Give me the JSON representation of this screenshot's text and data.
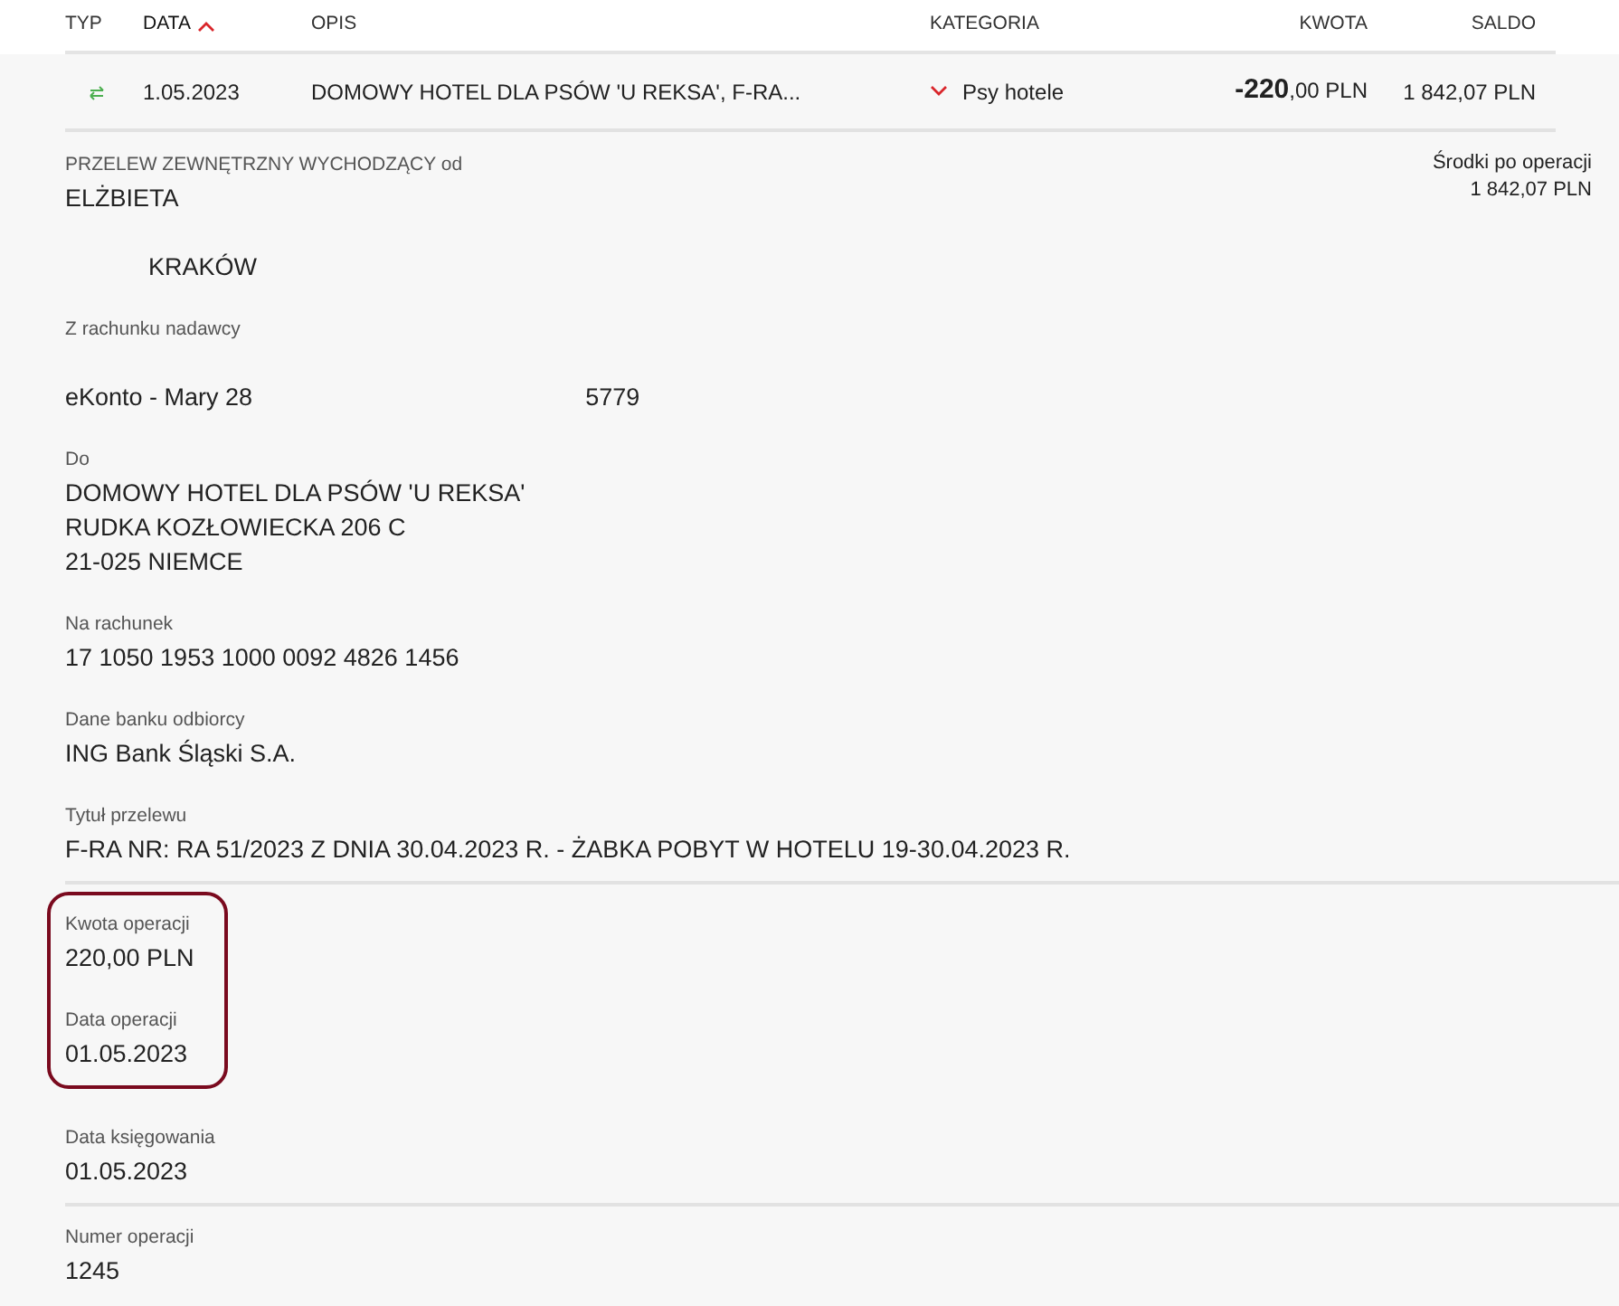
{
  "table": {
    "columns": [
      {
        "label": "TYP",
        "sorted": false
      },
      {
        "label": "DATA",
        "sorted": true
      },
      {
        "label": "OPIS",
        "sorted": false
      },
      {
        "label": "KATEGORIA",
        "sorted": false
      },
      {
        "label": "KWOTA",
        "sorted": false
      },
      {
        "label": "SALDO",
        "sorted": false
      }
    ],
    "rows": [
      {
        "date": "1.05.2023",
        "description": "DOMOWY HOTEL DLA PSÓW 'U REKSA', F-RA...",
        "category": "Psy hotele",
        "expanded": true,
        "amount": "**-220**,00 PLN",
        "balance": "1 842,07 PLN"
      }
    ]
  },
  "details": {
    "sender": {
      "label": "PRZELEW ZEWNĘTRZNY WYCHODZĄCY od",
      "name": "ELŻBIETA",
      "city": "KRAKÓW"
    },
    "balance_after": {
      "label": "Środki po operacji",
      "value": "1 842,07 PLN"
    },
    "fields": [
      {
        "kind": "account",
        "label": "Z rachunku nadawcy",
        "name": "eKonto - Mary 28",
        "suffix": "5779",
        "highlighted": false,
        "divider_before": false
      },
      {
        "kind": "text",
        "label": "Do",
        "lines": [
          "DOMOWY HOTEL DLA PSÓW 'U REKSA'",
          "RUDKA KOZŁOWIECKA 206 C",
          "21-025 NIEMCE"
        ],
        "highlighted": false,
        "divider_before": false
      },
      {
        "kind": "text",
        "label": "Na rachunek",
        "lines": [
          "17 1050 1953 1000 0092 4826 1456"
        ],
        "highlighted": false,
        "divider_before": false
      },
      {
        "kind": "text",
        "label": "Dane banku odbiorcy",
        "lines": [
          "ING Bank Śląski S.A."
        ],
        "highlighted": false,
        "divider_before": false
      },
      {
        "kind": "text",
        "label": "Tytuł przelewu",
        "lines": [
          "F-RA NR: RA 51/2023 Z DNIA 30.04.2023 R. - ŻABKA POBYT W HOTELU 19-30.04.2023 R."
        ],
        "highlighted": false,
        "divider_before": false
      },
      {
        "kind": "text",
        "label": "Kwota operacji",
        "lines": [
          "220,00 PLN"
        ],
        "highlighted": true,
        "divider_before": true
      },
      {
        "kind": "text",
        "label": "Data operacji",
        "lines": [
          "01.05.2023"
        ],
        "highlighted": true,
        "divider_before": false
      },
      {
        "kind": "text",
        "label": "Data księgowania",
        "lines": [
          "01.05.2023"
        ],
        "highlighted": false,
        "divider_before": false
      },
      {
        "kind": "text",
        "label": "Numer operacji",
        "lines": [
          "1245"
        ],
        "highlighted": false,
        "divider_before": true
      }
    ]
  }
}
